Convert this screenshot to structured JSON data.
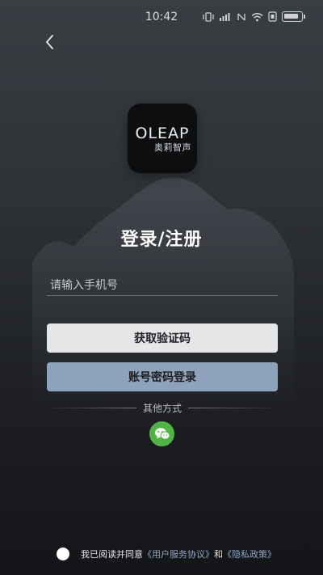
{
  "status_bar": {
    "time": "10:42"
  },
  "navigation": {
    "back_icon": "chevron-left-icon"
  },
  "logo": {
    "text_main": "OLEAP",
    "text_sub": "奥莉智声"
  },
  "page": {
    "title": "登录/注册"
  },
  "phone": {
    "placeholder": "请输入手机号",
    "value": ""
  },
  "buttons": {
    "get_code": "获取验证码",
    "password_login": "账号密码登录"
  },
  "other_methods": {
    "label": "其他方式",
    "wechat_icon": "wechat-icon"
  },
  "agreement": {
    "prefix": "我已阅读并同意",
    "terms_link": "《用户服务协议》",
    "conjunction": "和",
    "privacy_link": "《隐私政策》"
  },
  "colors": {
    "background_top": "#3a3d43",
    "background_bottom": "#141518",
    "button_primary": "#e5e6e8",
    "button_secondary": "#8ea2bb",
    "wechat_green": "#4fb443",
    "link": "#8fa7c7"
  }
}
